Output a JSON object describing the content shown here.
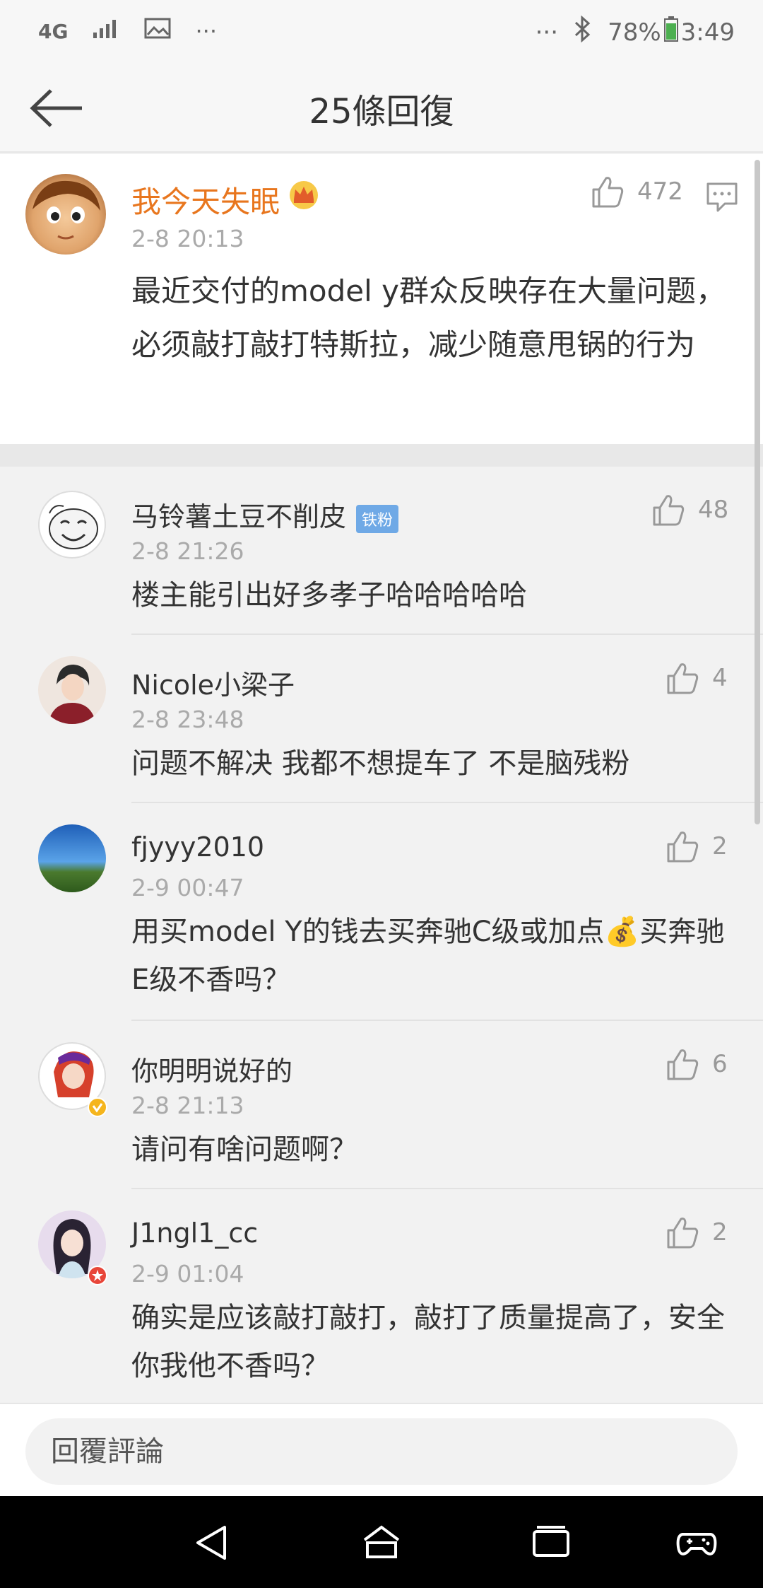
{
  "status_bar": {
    "network": "4G",
    "more_left": "···",
    "more_right": "···",
    "battery": "78%",
    "time": "3:49"
  },
  "header": {
    "title": "25條回復"
  },
  "root_comment": {
    "user": "我今天失眠",
    "time": "2-8 20:13",
    "likes": "472",
    "text": "最近交付的model y群众反映存在大量问题，必须敲打敲打特斯拉，减少随意甩锅的行为"
  },
  "replies": [
    {
      "user": "马铃薯土豆不削皮",
      "badge": "铁粉",
      "time": "2-8 21:26",
      "likes": "48",
      "text": "楼主能引出好多孝子哈哈哈哈哈"
    },
    {
      "user": "Nicole小梁子",
      "time": "2-8 23:48",
      "likes": "4",
      "text": "问题不解决 我都不想提车了 不是脑残粉"
    },
    {
      "user": "fjyyy2010",
      "time": "2-9 00:47",
      "likes": "2",
      "text": "用买model Y的钱去买奔驰C级或加点💰买奔驰E级不香吗？"
    },
    {
      "user": "你明明说好的",
      "time": "2-8 21:13",
      "likes": "6",
      "text": "请问有啥问题啊？"
    },
    {
      "user": "J1ngl1_cc",
      "time": "2-9 01:04",
      "likes": "2",
      "text": "确实是应该敲打敲打，敲打了质量提高了，安全你我他不香吗？"
    }
  ],
  "input": {
    "placeholder": "回覆評論"
  },
  "colors": {
    "accent_username": "#e8761e",
    "badge": "#6fa9e6"
  }
}
